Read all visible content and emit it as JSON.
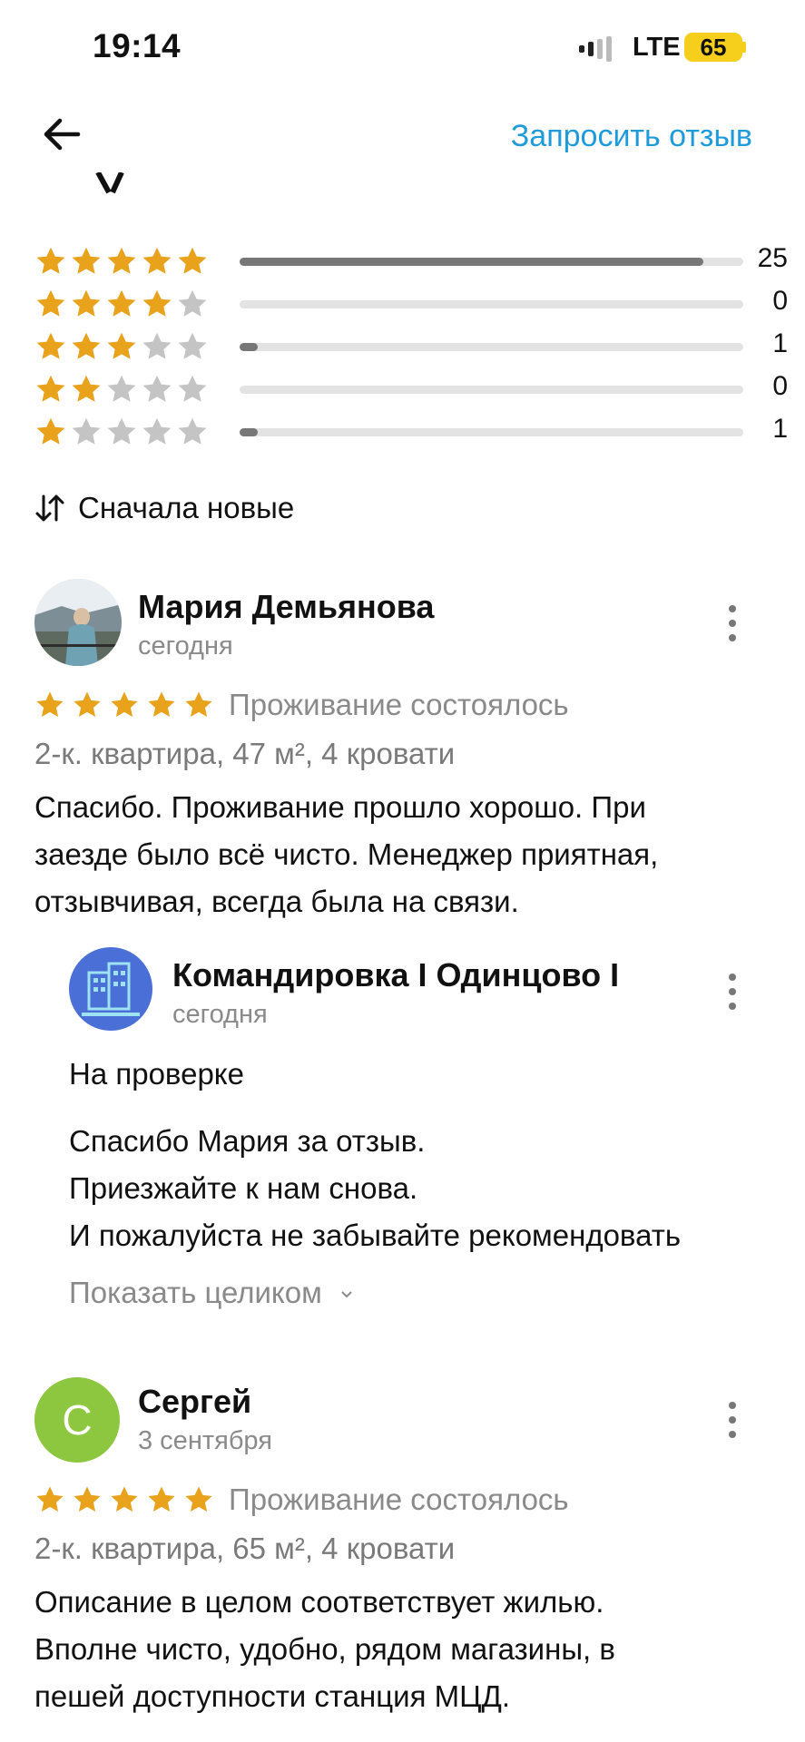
{
  "status_bar": {
    "time": "19:14",
    "network": "LTE",
    "battery": "65"
  },
  "header": {
    "request_review": "Запросить отзыв",
    "back_icon": "arrow-left-icon"
  },
  "ratings": {
    "max_count": 25,
    "rows": [
      {
        "stars": 5,
        "count": "25",
        "fraction": 0.92
      },
      {
        "stars": 4,
        "count": "0",
        "fraction": 0
      },
      {
        "stars": 3,
        "count": "1",
        "fraction": 0.036
      },
      {
        "stars": 2,
        "count": "0",
        "fraction": 0
      },
      {
        "stars": 1,
        "count": "1",
        "fraction": 0.036
      }
    ]
  },
  "sort": {
    "label": "Сначала новые"
  },
  "colors": {
    "star_gold": "#e8a21c",
    "star_grey": "#c4c4c4",
    "link_blue": "#1f9bdb",
    "avatar_green": "#8dc63f",
    "host_blue": "#4a6fd6"
  },
  "reviews": [
    {
      "author": "Мария Демьянова",
      "date": "сегодня",
      "rating": 5,
      "status": "Проживание состоялось",
      "apartment": "2-к. квартира, 47 м², 4 кровати",
      "text_lines": [
        "Спасибо. Проживание прошло хорошо. При",
        "заезде было всё чисто. Менеджер приятная,",
        "отзывчивая, всегда была на связи."
      ],
      "reply": {
        "author": "Командировка I Одинцово I",
        "date": "сегодня",
        "moderation": "На проверке",
        "lines": [
          "Спасибо Мария за отзыв.",
          "Приезжайте к нам снова.",
          "И пожалуйста не забывайте рекомендовать"
        ],
        "show_more": "Показать целиком"
      }
    },
    {
      "author": "Сергей",
      "avatar_letter": "С",
      "date": "3 сентября",
      "rating": 5,
      "status": "Проживание состоялось",
      "apartment": "2-к. квартира, 65 м², 4 кровати",
      "text_lines": [
        "Описание в целом соответствует жилью.",
        "Вполне чисто, удобно, рядом магазины, в",
        "пешей доступности станция МЦД."
      ]
    }
  ]
}
